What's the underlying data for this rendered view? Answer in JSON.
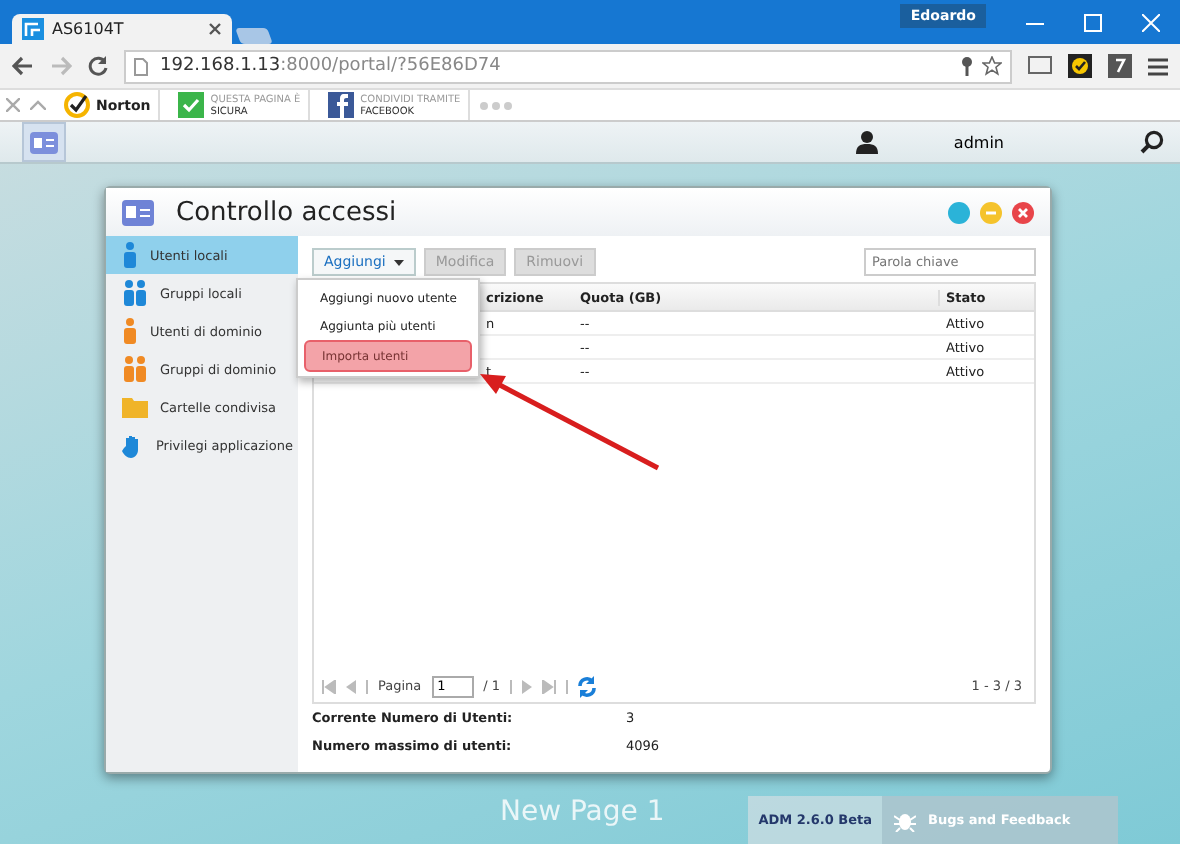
{
  "browser": {
    "tab": {
      "label": "AS6104T",
      "selected": true
    },
    "profile": "Edoardo",
    "address_host": "192.168.1.13",
    "address_rest": ":8000/portal/?56E86D74",
    "toolbar": [
      {
        "kind": "norton",
        "line1": "Norton"
      },
      {
        "kind": "check",
        "line1": "QUESTA PAGINA È",
        "line2": "SICURA"
      },
      {
        "kind": "facebook",
        "line1": "CONDIVIDI TRAMITE",
        "line2": "FACEBOOK"
      }
    ]
  },
  "app_bar": {
    "user": "admin"
  },
  "window": {
    "title": "Controllo accessi",
    "sidebar": [
      {
        "label": "Utenti locali",
        "kind": "user",
        "color": "#1e88d8",
        "selected": true
      },
      {
        "label": "Gruppi locali",
        "kind": "group",
        "color": "#1e88d8",
        "selected": false
      },
      {
        "label": "Utenti di dominio",
        "kind": "user",
        "color": "#f08a24",
        "selected": false
      },
      {
        "label": "Gruppi di dominio",
        "kind": "group",
        "color": "#f08a24",
        "selected": false
      },
      {
        "label": "Cartelle condivisa",
        "kind": "folder",
        "color": "#f0b429",
        "selected": false
      },
      {
        "label": "Privilegi applicazione",
        "kind": "hand",
        "color": "#1e88d8",
        "selected": false
      }
    ],
    "buttons": [
      {
        "label": "Aggiungi",
        "kind": "dropdown",
        "disabled": false
      },
      {
        "label": "Modifica",
        "kind": "plain",
        "disabled": true
      },
      {
        "label": "Rimuovi",
        "kind": "plain",
        "disabled": true
      }
    ],
    "search": {
      "placeholder": "Parola chiave"
    },
    "menu": [
      {
        "label": "Aggiungi nuovo utente",
        "selected": false
      },
      {
        "label": "Aggiunta più utenti",
        "selected": false
      },
      {
        "label": "Importa utenti",
        "selected": true
      }
    ],
    "table": {
      "columns": [
        "crizione",
        "Quota (GB)",
        "Stato"
      ],
      "rows": [
        [
          "n",
          "--",
          "Attivo"
        ],
        [
          "",
          "--",
          "Attivo"
        ],
        [
          "t",
          "--",
          "Attivo"
        ]
      ]
    },
    "pager": {
      "page_label": "Pagina",
      "page": "1",
      "of": "/ 1",
      "range": "1 - 3 / 3"
    },
    "stats": [
      {
        "label": "Corrente Numero di Utenti:",
        "value": "3"
      },
      {
        "label": "Numero massimo di utenti:",
        "value": "4096"
      }
    ]
  },
  "footer": {
    "page_name": "New Page 1",
    "version": "ADM 2.6.0 Beta",
    "feedback": "Bugs and Feedback"
  }
}
